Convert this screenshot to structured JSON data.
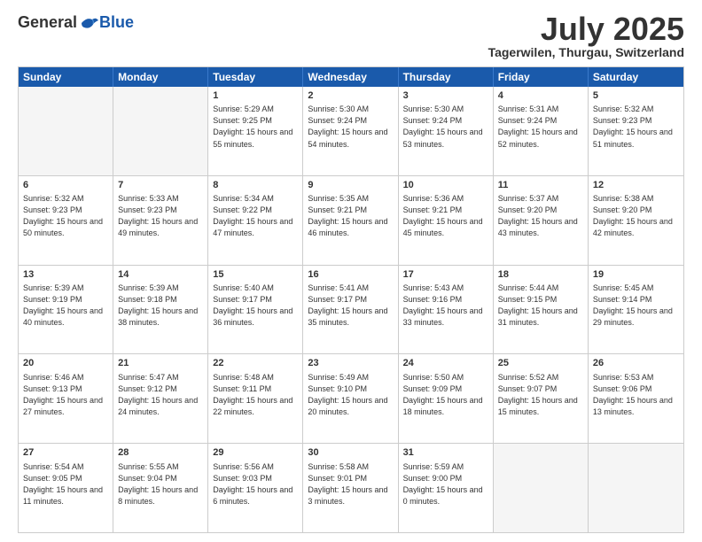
{
  "logo": {
    "general": "General",
    "blue": "Blue"
  },
  "title": "July 2025",
  "location": "Tagerwilen, Thurgau, Switzerland",
  "header_days": [
    "Sunday",
    "Monday",
    "Tuesday",
    "Wednesday",
    "Thursday",
    "Friday",
    "Saturday"
  ],
  "weeks": [
    [
      {
        "day": "",
        "empty": true
      },
      {
        "day": "",
        "empty": true
      },
      {
        "day": "1",
        "sunrise": "Sunrise: 5:29 AM",
        "sunset": "Sunset: 9:25 PM",
        "daylight": "Daylight: 15 hours and 55 minutes."
      },
      {
        "day": "2",
        "sunrise": "Sunrise: 5:30 AM",
        "sunset": "Sunset: 9:24 PM",
        "daylight": "Daylight: 15 hours and 54 minutes."
      },
      {
        "day": "3",
        "sunrise": "Sunrise: 5:30 AM",
        "sunset": "Sunset: 9:24 PM",
        "daylight": "Daylight: 15 hours and 53 minutes."
      },
      {
        "day": "4",
        "sunrise": "Sunrise: 5:31 AM",
        "sunset": "Sunset: 9:24 PM",
        "daylight": "Daylight: 15 hours and 52 minutes."
      },
      {
        "day": "5",
        "sunrise": "Sunrise: 5:32 AM",
        "sunset": "Sunset: 9:23 PM",
        "daylight": "Daylight: 15 hours and 51 minutes."
      }
    ],
    [
      {
        "day": "6",
        "sunrise": "Sunrise: 5:32 AM",
        "sunset": "Sunset: 9:23 PM",
        "daylight": "Daylight: 15 hours and 50 minutes."
      },
      {
        "day": "7",
        "sunrise": "Sunrise: 5:33 AM",
        "sunset": "Sunset: 9:23 PM",
        "daylight": "Daylight: 15 hours and 49 minutes."
      },
      {
        "day": "8",
        "sunrise": "Sunrise: 5:34 AM",
        "sunset": "Sunset: 9:22 PM",
        "daylight": "Daylight: 15 hours and 47 minutes."
      },
      {
        "day": "9",
        "sunrise": "Sunrise: 5:35 AM",
        "sunset": "Sunset: 9:21 PM",
        "daylight": "Daylight: 15 hours and 46 minutes."
      },
      {
        "day": "10",
        "sunrise": "Sunrise: 5:36 AM",
        "sunset": "Sunset: 9:21 PM",
        "daylight": "Daylight: 15 hours and 45 minutes."
      },
      {
        "day": "11",
        "sunrise": "Sunrise: 5:37 AM",
        "sunset": "Sunset: 9:20 PM",
        "daylight": "Daylight: 15 hours and 43 minutes."
      },
      {
        "day": "12",
        "sunrise": "Sunrise: 5:38 AM",
        "sunset": "Sunset: 9:20 PM",
        "daylight": "Daylight: 15 hours and 42 minutes."
      }
    ],
    [
      {
        "day": "13",
        "sunrise": "Sunrise: 5:39 AM",
        "sunset": "Sunset: 9:19 PM",
        "daylight": "Daylight: 15 hours and 40 minutes."
      },
      {
        "day": "14",
        "sunrise": "Sunrise: 5:39 AM",
        "sunset": "Sunset: 9:18 PM",
        "daylight": "Daylight: 15 hours and 38 minutes."
      },
      {
        "day": "15",
        "sunrise": "Sunrise: 5:40 AM",
        "sunset": "Sunset: 9:17 PM",
        "daylight": "Daylight: 15 hours and 36 minutes."
      },
      {
        "day": "16",
        "sunrise": "Sunrise: 5:41 AM",
        "sunset": "Sunset: 9:17 PM",
        "daylight": "Daylight: 15 hours and 35 minutes."
      },
      {
        "day": "17",
        "sunrise": "Sunrise: 5:43 AM",
        "sunset": "Sunset: 9:16 PM",
        "daylight": "Daylight: 15 hours and 33 minutes."
      },
      {
        "day": "18",
        "sunrise": "Sunrise: 5:44 AM",
        "sunset": "Sunset: 9:15 PM",
        "daylight": "Daylight: 15 hours and 31 minutes."
      },
      {
        "day": "19",
        "sunrise": "Sunrise: 5:45 AM",
        "sunset": "Sunset: 9:14 PM",
        "daylight": "Daylight: 15 hours and 29 minutes."
      }
    ],
    [
      {
        "day": "20",
        "sunrise": "Sunrise: 5:46 AM",
        "sunset": "Sunset: 9:13 PM",
        "daylight": "Daylight: 15 hours and 27 minutes."
      },
      {
        "day": "21",
        "sunrise": "Sunrise: 5:47 AM",
        "sunset": "Sunset: 9:12 PM",
        "daylight": "Daylight: 15 hours and 24 minutes."
      },
      {
        "day": "22",
        "sunrise": "Sunrise: 5:48 AM",
        "sunset": "Sunset: 9:11 PM",
        "daylight": "Daylight: 15 hours and 22 minutes."
      },
      {
        "day": "23",
        "sunrise": "Sunrise: 5:49 AM",
        "sunset": "Sunset: 9:10 PM",
        "daylight": "Daylight: 15 hours and 20 minutes."
      },
      {
        "day": "24",
        "sunrise": "Sunrise: 5:50 AM",
        "sunset": "Sunset: 9:09 PM",
        "daylight": "Daylight: 15 hours and 18 minutes."
      },
      {
        "day": "25",
        "sunrise": "Sunrise: 5:52 AM",
        "sunset": "Sunset: 9:07 PM",
        "daylight": "Daylight: 15 hours and 15 minutes."
      },
      {
        "day": "26",
        "sunrise": "Sunrise: 5:53 AM",
        "sunset": "Sunset: 9:06 PM",
        "daylight": "Daylight: 15 hours and 13 minutes."
      }
    ],
    [
      {
        "day": "27",
        "sunrise": "Sunrise: 5:54 AM",
        "sunset": "Sunset: 9:05 PM",
        "daylight": "Daylight: 15 hours and 11 minutes."
      },
      {
        "day": "28",
        "sunrise": "Sunrise: 5:55 AM",
        "sunset": "Sunset: 9:04 PM",
        "daylight": "Daylight: 15 hours and 8 minutes."
      },
      {
        "day": "29",
        "sunrise": "Sunrise: 5:56 AM",
        "sunset": "Sunset: 9:03 PM",
        "daylight": "Daylight: 15 hours and 6 minutes."
      },
      {
        "day": "30",
        "sunrise": "Sunrise: 5:58 AM",
        "sunset": "Sunset: 9:01 PM",
        "daylight": "Daylight: 15 hours and 3 minutes."
      },
      {
        "day": "31",
        "sunrise": "Sunrise: 5:59 AM",
        "sunset": "Sunset: 9:00 PM",
        "daylight": "Daylight: 15 hours and 0 minutes."
      },
      {
        "day": "",
        "empty": true
      },
      {
        "day": "",
        "empty": true
      }
    ]
  ]
}
